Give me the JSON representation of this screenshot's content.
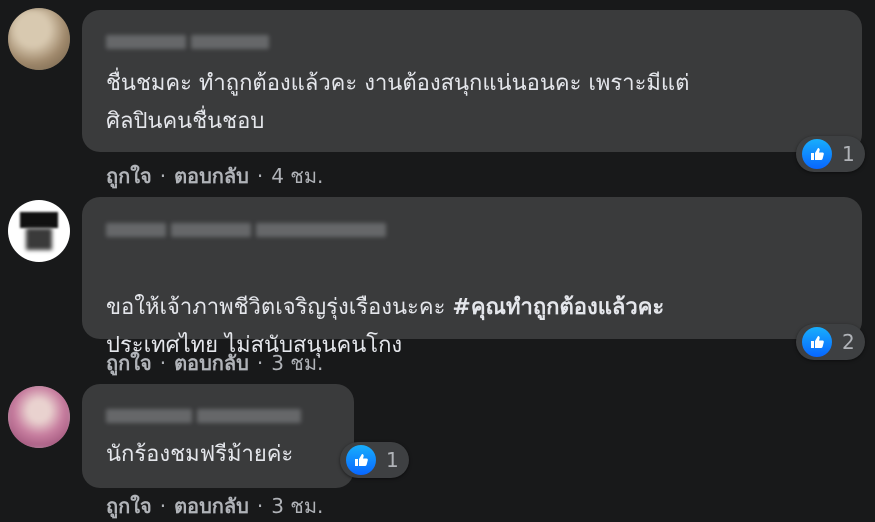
{
  "comments": [
    {
      "text": "ชื่นชมคะ ทำถูกต้องแล้วคะ งานต้องสนุกแน่นอนคะ เพราะมีแต่\nศิลปินคนชื่นชอบ",
      "reaction_count": "1",
      "like_label": "ถูกใจ",
      "reply_label": "ตอบกลับ",
      "time": "4 ชม."
    },
    {
      "text_prefix": "ขอให้เจ้าภาพชีวิตเจริญรุ่งเรืองนะคะ ",
      "hashtag": "#คุณทำถูกต้องแล้วคะ",
      "text_line2": "ประเทศไทย ไม่สนับสนุนคนโกง",
      "reaction_count": "2",
      "like_label": "ถูกใจ",
      "reply_label": "ตอบกลับ",
      "time": "3 ชม."
    },
    {
      "text": "นักร้องชมฟรีม้ายค่ะ",
      "reaction_count": "1",
      "like_label": "ถูกใจ",
      "reply_label": "ตอบกลับ",
      "time": "3 ชม."
    }
  ],
  "icons": {
    "reaction": "like-thumbs-up-icon"
  },
  "colors": {
    "background": "#18191a",
    "bubble": "#3a3b3c",
    "like_blue": "#0866ff"
  }
}
